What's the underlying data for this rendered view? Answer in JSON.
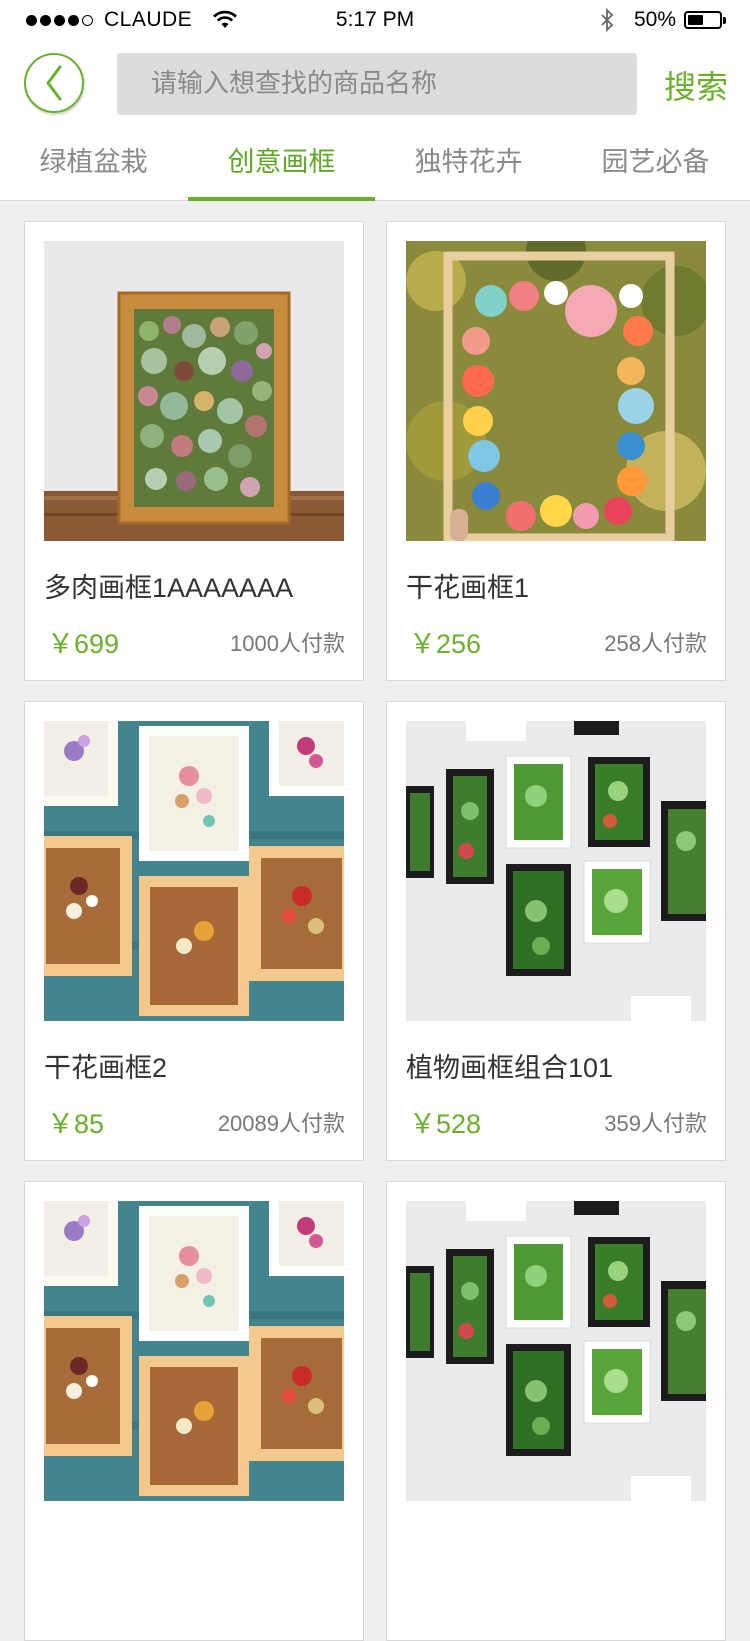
{
  "status_bar": {
    "carrier": "CLAUDE",
    "time": "5:17 PM",
    "battery_text": "50%",
    "battery_level": 0.5
  },
  "header": {
    "back_icon": "chevron-left-icon",
    "search_placeholder": "请输入想查找的商品名称",
    "search_label": "搜索"
  },
  "tabs": [
    {
      "label": "绿植盆栽",
      "active": false
    },
    {
      "label": "创意画框",
      "active": true
    },
    {
      "label": "独特花卉",
      "active": false
    },
    {
      "label": "园艺必备",
      "active": false
    }
  ],
  "products": [
    {
      "title": "多肉画框1AAAAAAA",
      "price": "￥699",
      "sales": "1000人付款",
      "image": "succulent-frame"
    },
    {
      "title": "干花画框1",
      "price": "￥256",
      "sales": "258人付款",
      "image": "dried-flower-ring-frame"
    },
    {
      "title": "干花画框2",
      "price": "￥85",
      "sales": "20089人付款",
      "image": "dried-flower-frames"
    },
    {
      "title": "植物画框组合101",
      "price": "￥528",
      "sales": "359人付款",
      "image": "plant-frame-set"
    },
    {
      "title": "",
      "price": "",
      "sales": "",
      "image": "dried-flower-frames"
    },
    {
      "title": "",
      "price": "",
      "sales": "",
      "image": "plant-frame-set"
    }
  ],
  "colors": {
    "accent": "#6ab02e",
    "background": "#efefef",
    "search_bg": "#dcdcdc"
  }
}
